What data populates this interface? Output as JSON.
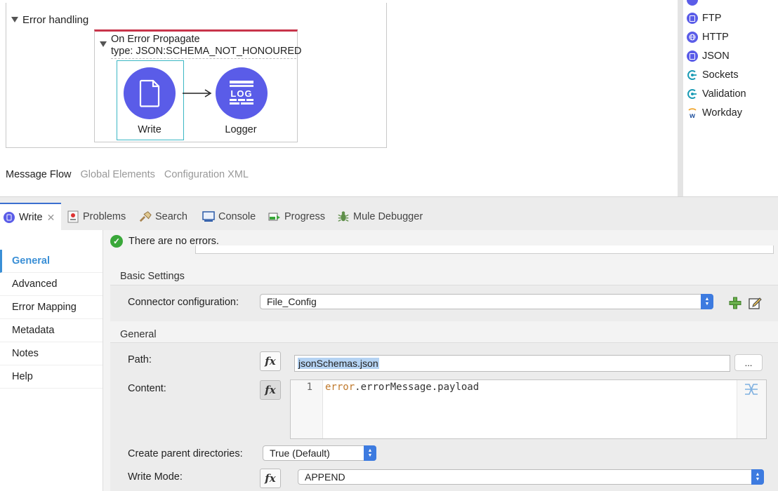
{
  "canvas": {
    "error_handling_label": "Error handling",
    "on_error": {
      "title": "On Error Propagate",
      "type": "type: JSON:SCHEMA_NOT_HONOURED"
    },
    "components": [
      {
        "label": "Write",
        "icon": "file-icon"
      },
      {
        "label": "Logger",
        "icon": "log-icon"
      }
    ],
    "editor_tabs": [
      "Message Flow",
      "Global Elements",
      "Configuration XML"
    ]
  },
  "palette": {
    "items": [
      "FTP",
      "HTTP",
      "JSON",
      "Sockets",
      "Validation",
      "Workday"
    ]
  },
  "view_tabs": {
    "write": "Write",
    "problems": "Problems",
    "search": "Search",
    "console": "Console",
    "progress": "Progress",
    "debugger": "Mule Debugger"
  },
  "nav": [
    "General",
    "Advanced",
    "Error Mapping",
    "Metadata",
    "Notes",
    "Help"
  ],
  "status": {
    "message": "There are no errors."
  },
  "basic_settings": {
    "title": "Basic Settings",
    "connector_label": "Connector configuration:",
    "connector_value": "File_Config"
  },
  "general": {
    "title": "General",
    "path_label": "Path:",
    "path_value": "jsonSchemas.json",
    "browse_label": "...",
    "content_label": "Content:",
    "code_line_number": "1",
    "code_prefix": "error",
    "code_rest": ".errorMessage.payload",
    "create_dirs_label": "Create parent directories:",
    "create_dirs_value": "True (Default)",
    "write_mode_label": "Write Mode:",
    "write_mode_value": "APPEND",
    "fx_label": "fx"
  },
  "colors": {
    "accent": "#5a5ce8",
    "selection": "#3bb7c4",
    "error_bar": "#c8344a",
    "nav_active": "#3a8fd6"
  }
}
